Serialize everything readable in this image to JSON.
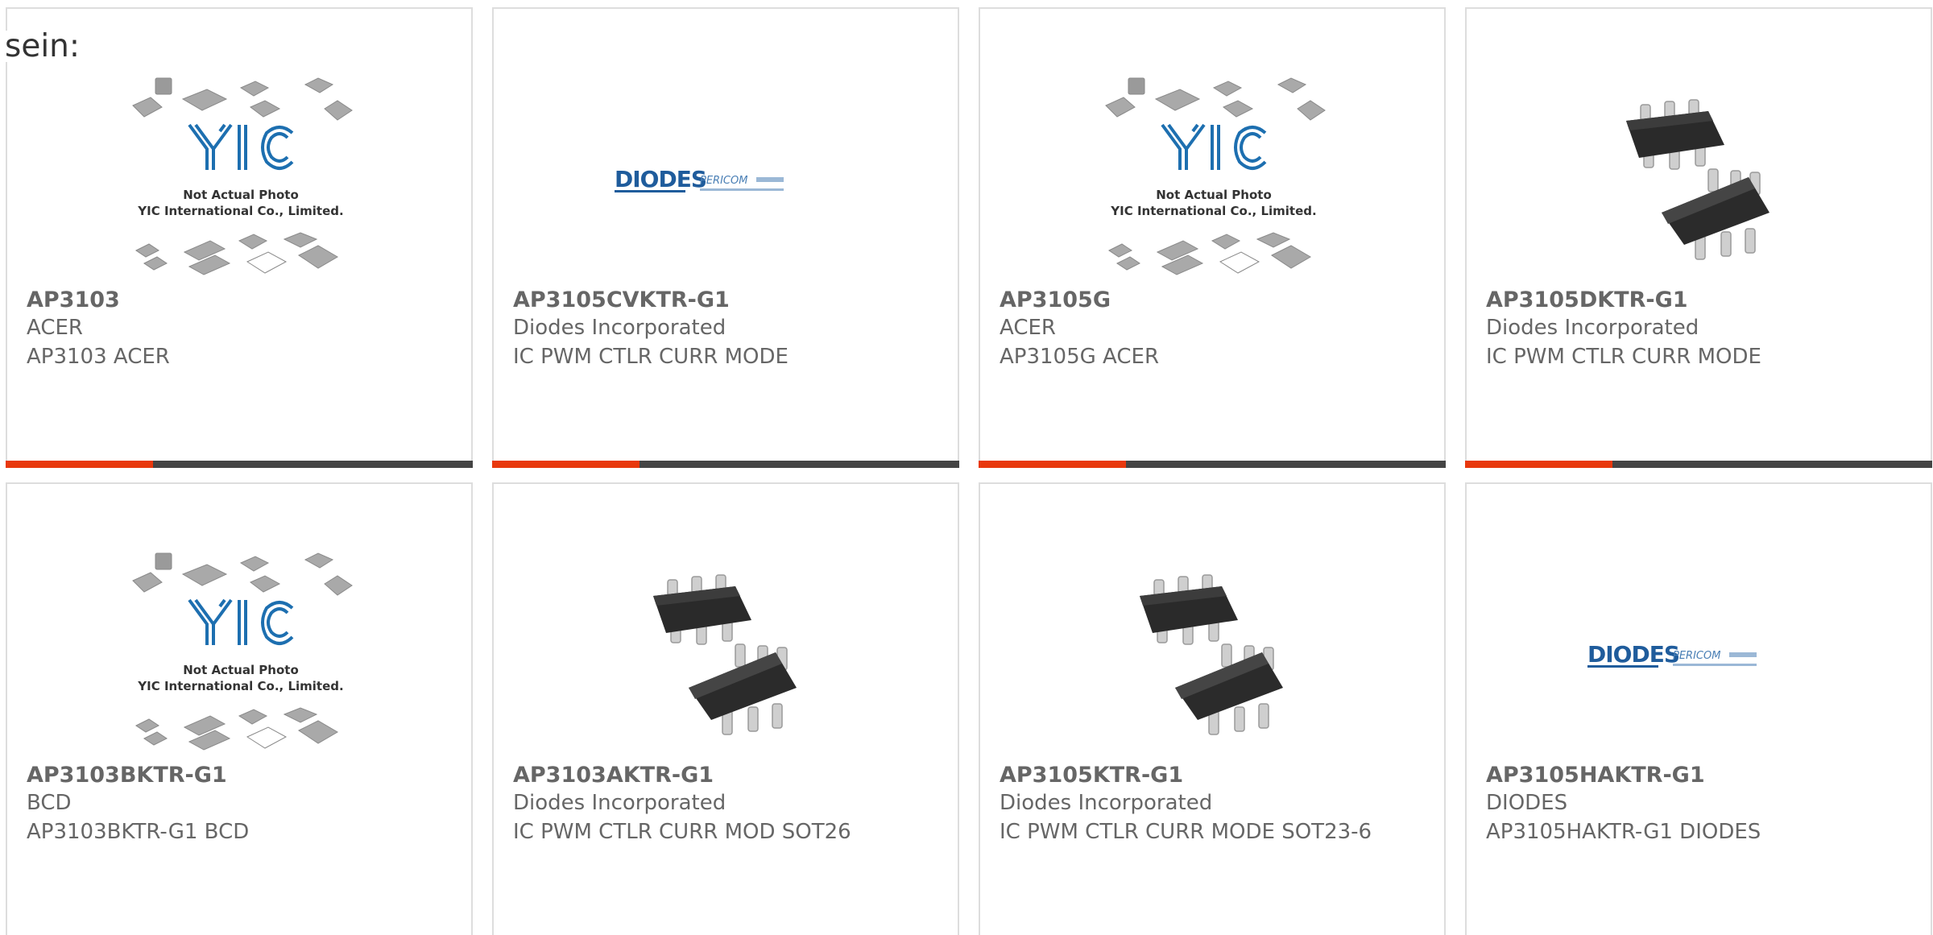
{
  "intro": {
    "text": "sein:"
  },
  "colors": {
    "accent": "#e8380d",
    "bar": "#444444",
    "border": "#dddddd",
    "text": "#666666"
  },
  "products": [
    {
      "part_number": "AP3103",
      "manufacturer": "ACER",
      "description": "AP3103 ACER",
      "image": "yic-placeholder",
      "placeholder_lines": [
        "Not Actual Photo",
        "YIC International Co., Limited."
      ]
    },
    {
      "part_number": "AP3105CVKTR-G1",
      "manufacturer": "Diodes Incorporated",
      "description": "IC PWM CTLR CURR MODE",
      "image": "diodes-logo",
      "logo_text": "DIODES",
      "logo_subtext": "PERICOM"
    },
    {
      "part_number": "AP3105G",
      "manufacturer": "ACER",
      "description": "AP3105G ACER",
      "image": "yic-placeholder",
      "placeholder_lines": [
        "Not Actual Photo",
        "YIC International Co., Limited."
      ]
    },
    {
      "part_number": "AP3105DKTR-G1",
      "manufacturer": "Diodes Incorporated",
      "description": "IC PWM CTLR CURR MODE",
      "image": "sot23-chip"
    },
    {
      "part_number": "AP3103BKTR-G1",
      "manufacturer": "BCD",
      "description": "AP3103BKTR-G1 BCD",
      "image": "yic-placeholder",
      "placeholder_lines": [
        "Not Actual Photo",
        "YIC International Co., Limited."
      ]
    },
    {
      "part_number": "AP3103AKTR-G1",
      "manufacturer": "Diodes Incorporated",
      "description": "IC PWM CTLR CURR MOD SOT26",
      "image": "sot23-chip"
    },
    {
      "part_number": "AP3105KTR-G1",
      "manufacturer": "Diodes Incorporated",
      "description": "IC PWM CTLR CURR MODE SOT23-6",
      "image": "sot23-chip"
    },
    {
      "part_number": "AP3105HAKTR-G1",
      "manufacturer": "DIODES",
      "description": "AP3105HAKTR-G1 DIODES",
      "image": "diodes-logo",
      "logo_text": "DIODES",
      "logo_subtext": "PERICOM"
    }
  ]
}
